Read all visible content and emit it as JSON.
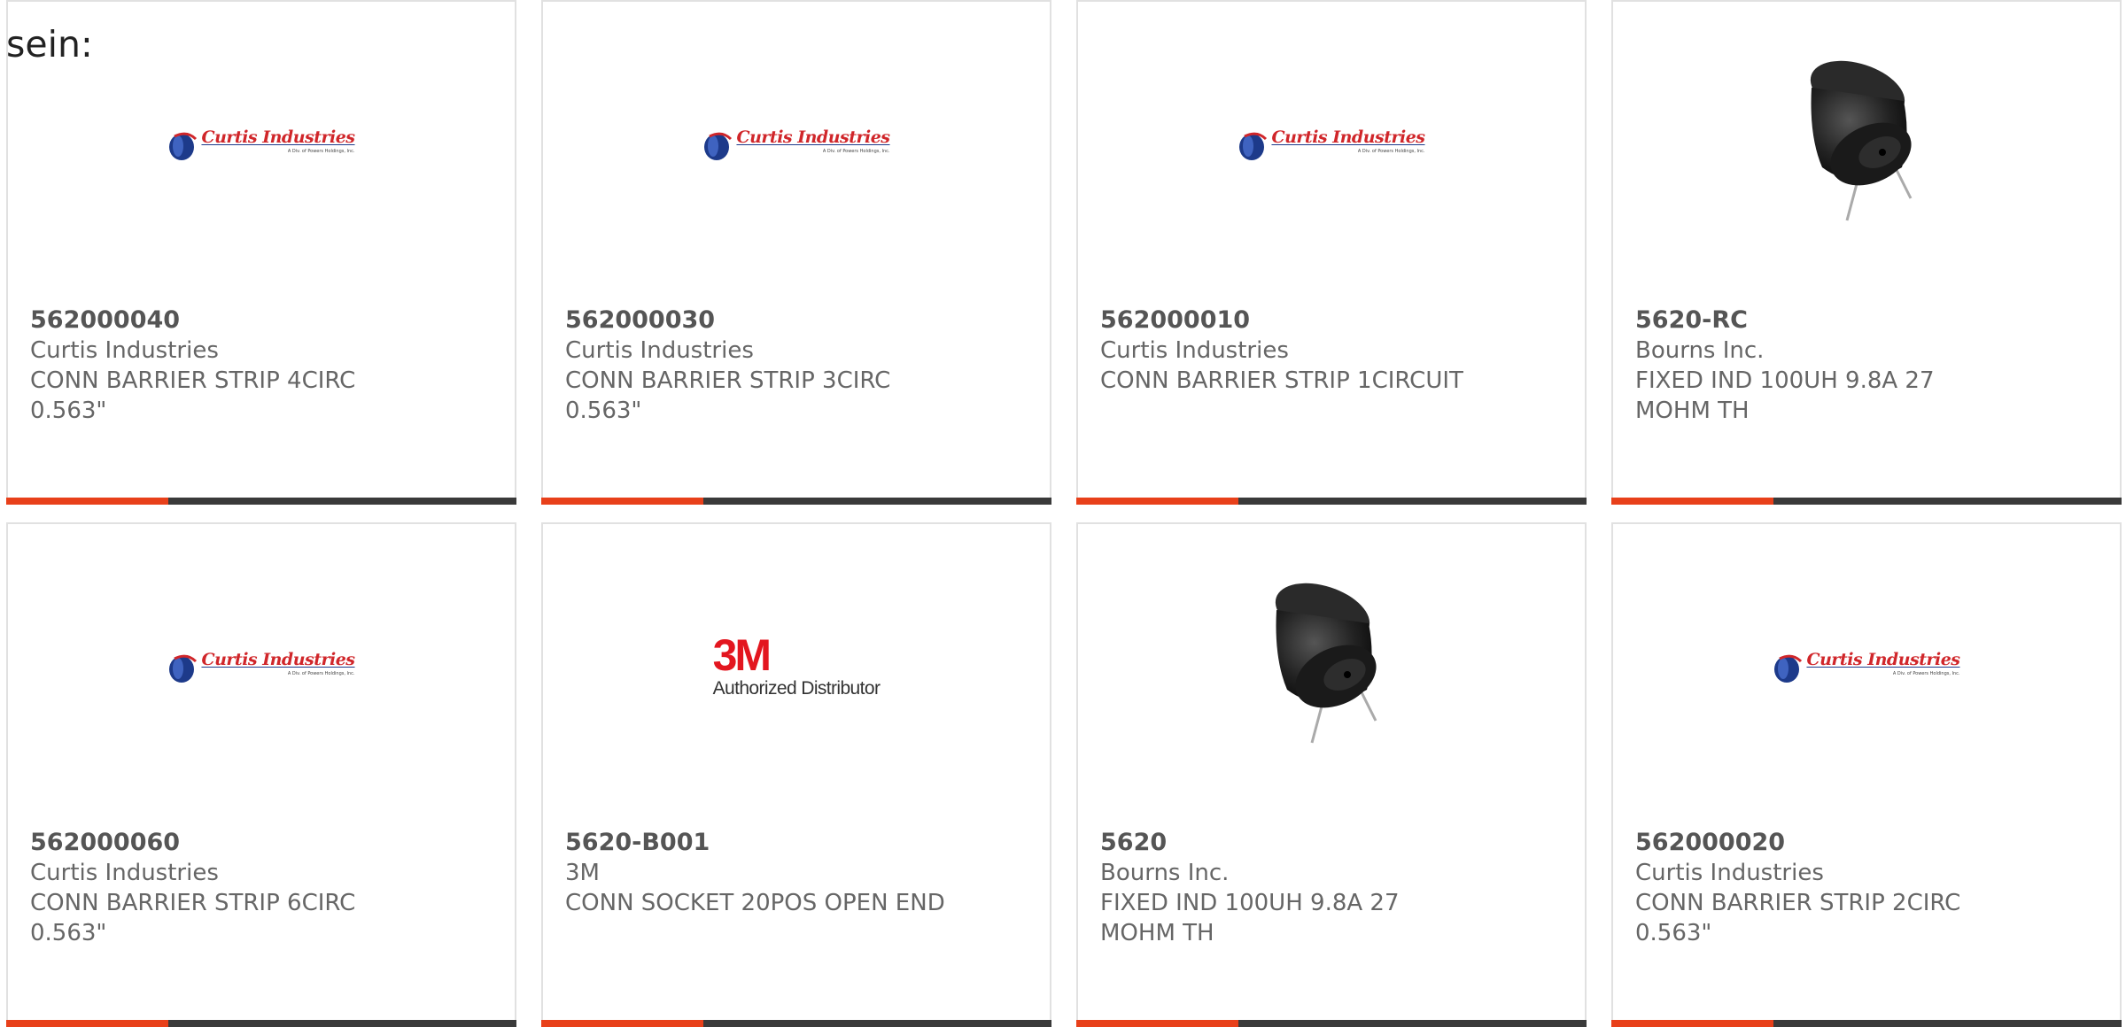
{
  "intro_text": "sein:",
  "colors": {
    "accent": "#e8401a",
    "bar": "#3a3a3a",
    "border": "#e1e1e1",
    "text": "#666666"
  },
  "products": [
    {
      "part_number": "562000040",
      "manufacturer": "Curtis Industries",
      "description": "CONN BARRIER STRIP 4CIRC 0.563\"",
      "image": "curtis-logo",
      "logo_brand": "Curtis Industries",
      "logo_sub": "A Div. of Powers Holdings, Inc."
    },
    {
      "part_number": "562000030",
      "manufacturer": "Curtis Industries",
      "description": "CONN BARRIER STRIP 3CIRC 0.563\"",
      "image": "curtis-logo",
      "logo_brand": "Curtis Industries",
      "logo_sub": "A Div. of Powers Holdings, Inc."
    },
    {
      "part_number": "562000010",
      "manufacturer": "Curtis Industries",
      "description": "CONN BARRIER STRIP 1CIRCUIT",
      "image": "curtis-logo",
      "logo_brand": "Curtis Industries",
      "logo_sub": "A Div. of Powers Holdings, Inc."
    },
    {
      "part_number": "5620-RC",
      "manufacturer": "Bourns Inc.",
      "description": "FIXED IND 100UH 9.8A 27 MOHM TH",
      "image": "inductor-photo"
    },
    {
      "part_number": "562000060",
      "manufacturer": "Curtis Industries",
      "description": "CONN BARRIER STRIP 6CIRC 0.563\"",
      "image": "curtis-logo",
      "logo_brand": "Curtis Industries",
      "logo_sub": "A Div. of Powers Holdings, Inc."
    },
    {
      "part_number": "5620-B001",
      "manufacturer": "3M",
      "description": "CONN SOCKET 20POS OPEN END",
      "image": "3m-logo",
      "logo_brand": "3M",
      "logo_sub": "Authorized Distributor"
    },
    {
      "part_number": "5620",
      "manufacturer": "Bourns Inc.",
      "description": "FIXED IND 100UH 9.8A 27 MOHM TH",
      "image": "inductor-photo"
    },
    {
      "part_number": "562000020",
      "manufacturer": "Curtis Industries",
      "description": "CONN BARRIER STRIP 2CIRC 0.563\"",
      "image": "curtis-logo",
      "logo_brand": "Curtis Industries",
      "logo_sub": "A Div. of Powers Holdings, Inc."
    }
  ]
}
